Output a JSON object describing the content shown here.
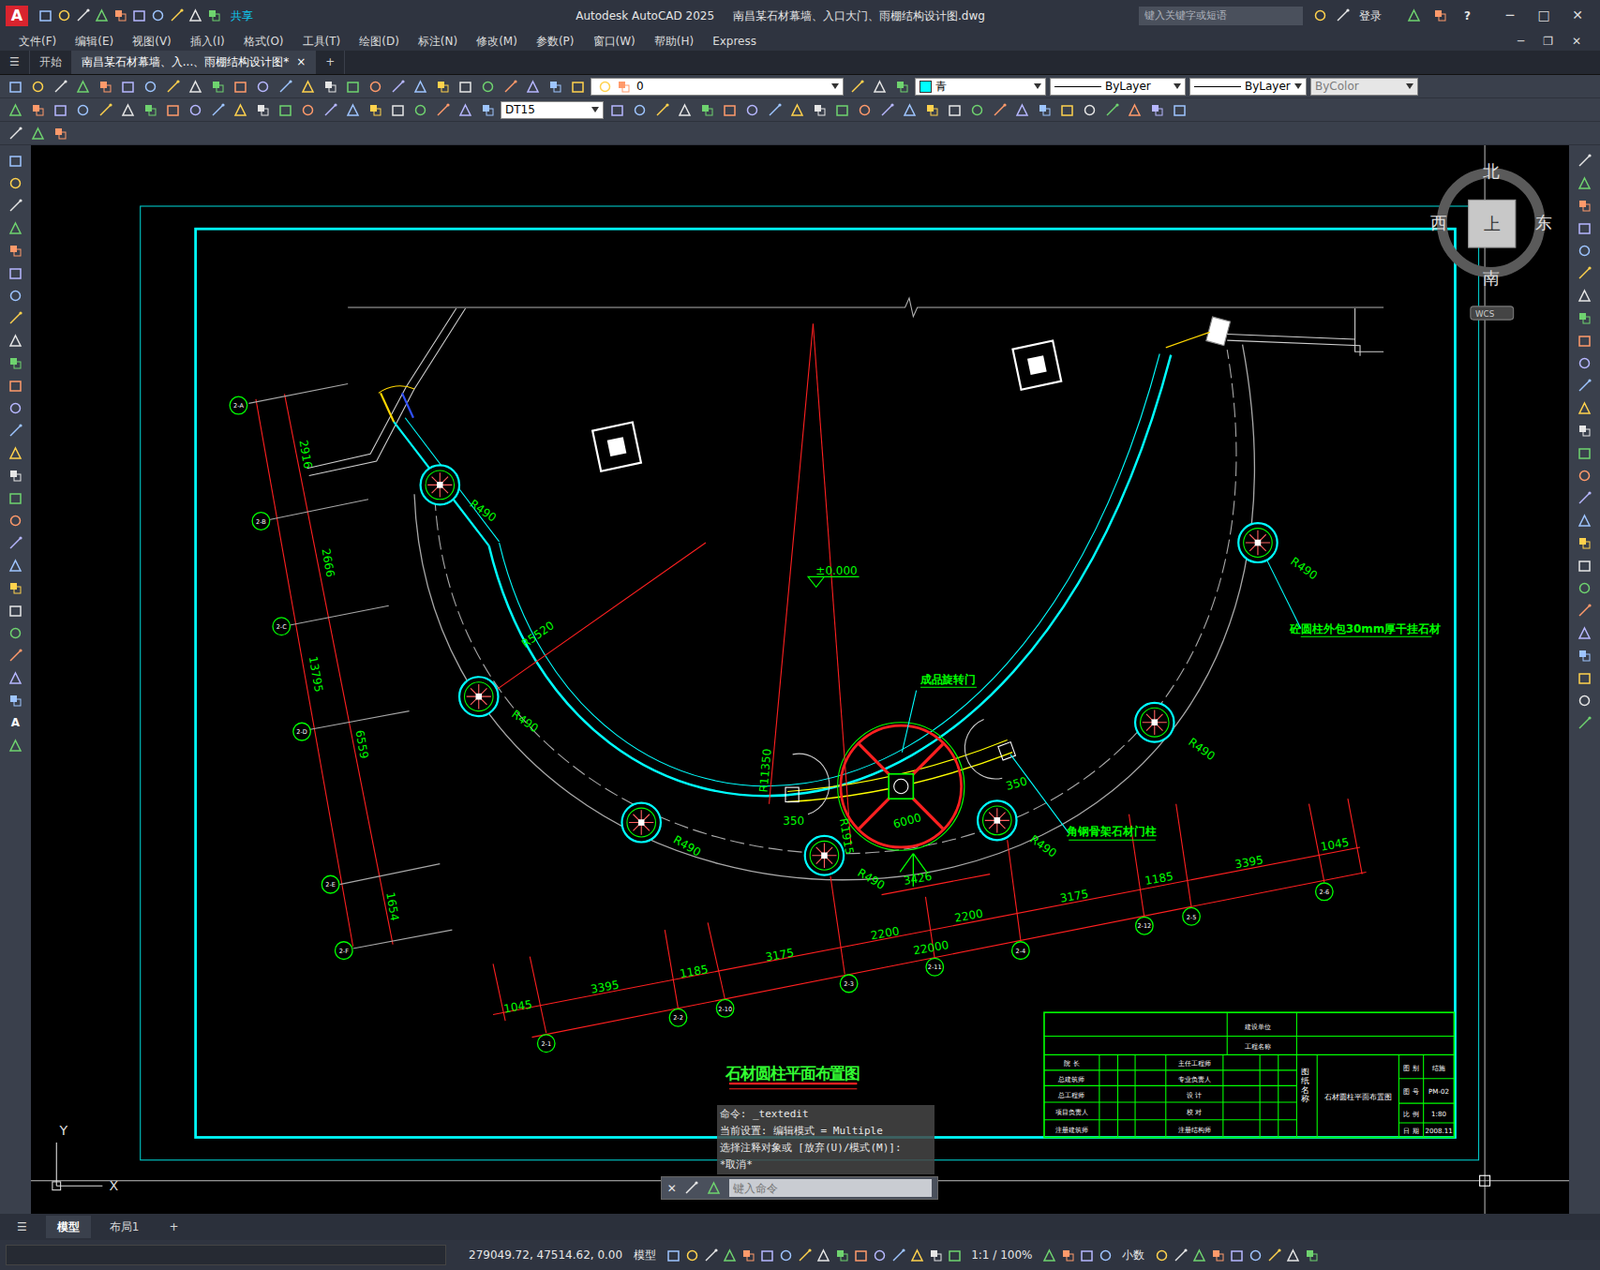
{
  "window": {
    "logo": "A",
    "title": "Autodesk AutoCAD 2025",
    "file": "南昌某石材幕墙、入口大门、雨棚结构设计图.dwg",
    "share": "共享",
    "search_placeholder": "键入关键字或短语",
    "login": "登录",
    "help": "?",
    "controls": [
      "─",
      "□",
      "✕"
    ]
  },
  "menu": {
    "items": [
      "文件(F)",
      "编辑(E)",
      "视图(V)",
      "插入(I)",
      "格式(O)",
      "工具(T)",
      "绘图(D)",
      "标注(N)",
      "修改(M)",
      "参数(P)",
      "窗口(W)",
      "帮助(H)",
      "Express"
    ],
    "controls": [
      "─",
      "❐",
      "✕"
    ]
  },
  "doc_tabs": {
    "menu": "☰",
    "items": [
      {
        "label": "开始",
        "selected": false
      },
      {
        "label": "南昌某石材幕墙、入...、雨棚结构设计图*",
        "selected": true
      }
    ],
    "close": "×",
    "add": "+"
  },
  "properties": {
    "layer": "0",
    "color": "青",
    "linetype": "ByLayer",
    "lineweight": "ByLayer",
    "plotstyle": {
      "label": "ByColor",
      "disabled": true
    },
    "text_style": "DT15"
  },
  "left_tools": {
    "text_tool": "A"
  },
  "viewcube": {
    "north": "北",
    "south": "南",
    "east": "东",
    "west": "西",
    "face": "上",
    "ucs": "WCS"
  },
  "ucs_icon": {
    "x": "X",
    "y": "Y"
  },
  "drawing": {
    "dims": [
      "2916",
      "2666",
      "13795",
      "6559",
      "1654",
      "R490",
      "R490",
      "R490",
      "R490",
      "R490",
      "R490",
      "R490",
      "R5520",
      "R11350",
      "±0.000",
      "6000",
      "350",
      "350",
      "R1915",
      "3426",
      "2200",
      "2200",
      "22000",
      "3175",
      "1185",
      "3395",
      "1045",
      "3175",
      "1185",
      "3395",
      "1045"
    ],
    "labels": [
      "成品旋转门",
      "砼圆柱外包30mm厚干挂石材",
      "角钢骨架石材门柱"
    ],
    "grid_bubbles": [
      "2-A",
      "2-B",
      "2-C",
      "2-D",
      "2-E",
      "2-F",
      "2-1",
      "2-2",
      "2-10",
      "2-3",
      "2-11",
      "2-4",
      "2-12",
      "2-5",
      "2-6"
    ],
    "title": "石材圆柱平面布置图",
    "title_block": [
      "建设单位",
      "工程名称",
      "院 长",
      "总建筑师",
      "总工程师",
      "项目负责人",
      "注册建筑师",
      "主任工程师",
      "专业负责人",
      "设 计",
      "校 对",
      "注册结构师",
      "石材圆柱平面布置图",
      "图 别",
      "结施",
      "图 号",
      "PM-02",
      "比 例",
      "1:80",
      "日 期",
      "2008.11"
    ],
    "title_block_vertical": "图纸名称"
  },
  "command": {
    "history": [
      "命令: _textedit",
      "当前设置: 编辑模式 = Multiple",
      "选择注释对象或 [放弃(U)/模式(M)]:",
      "*取消*"
    ],
    "close": "✕",
    "placeholder": "键入命令"
  },
  "layout_tabs": {
    "menu": "☰",
    "items": [
      {
        "label": "模型",
        "selected": true
      },
      {
        "label": "布局1",
        "selected": false
      }
    ],
    "add": "+"
  },
  "status": {
    "coords": "279049.72, 47514.62, 0.00",
    "space": "模型",
    "scale": "1:1 / 100%",
    "units": "小数"
  }
}
